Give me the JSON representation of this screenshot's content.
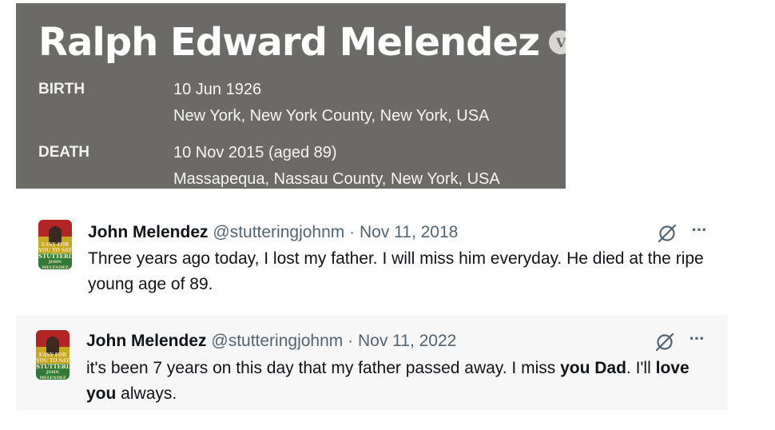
{
  "memorial": {
    "name": "Ralph Edward Melendez",
    "badge": "V",
    "birth_label": "BIRTH",
    "birth_date": "10 Jun 1926",
    "birth_place": "New York, New York County, New York, USA",
    "death_label": "DEATH",
    "death_date": "10 Nov 2015 (aged 89)",
    "death_place": "Massapequa, Nassau County, New York, USA",
    "background_color": "#6c6a66"
  },
  "tweets": [
    {
      "author": "John Melendez",
      "handle": "@stutteringjohnm",
      "separator": "·",
      "date": "Nov 11, 2018",
      "text": "Three years ago today, I lost my father. I will miss him everyday. He died at the ripe young age of 89.",
      "avatar_text": [
        "EASY FOR",
        "YOU TO SAY",
        "STUTTERING",
        "JOHN MELENDEZ"
      ]
    },
    {
      "author": "John Melendez",
      "handle": "@stutteringjohnm",
      "separator": "·",
      "date": "Nov 11, 2022",
      "text_parts": [
        {
          "t": "it's been 7 years on this day that my father passed away. I miss ",
          "bold": false
        },
        {
          "t": "you Dad",
          "bold": true
        },
        {
          "t": ". I'll ",
          "bold": false
        },
        {
          "t": "love you",
          "bold": true
        },
        {
          "t": " always.",
          "bold": false
        }
      ],
      "avatar_text": [
        "EASY FOR",
        "YOU TO SAY",
        "STUTTERING",
        "JOHN MELENDEZ"
      ]
    }
  ],
  "icons": {
    "grok": "grok-icon",
    "more": "more-icon",
    "more_glyph": "···"
  },
  "colors": {
    "text_primary": "#0f1419",
    "text_secondary": "#536471",
    "tweet2_background": "#f7f7f7"
  }
}
